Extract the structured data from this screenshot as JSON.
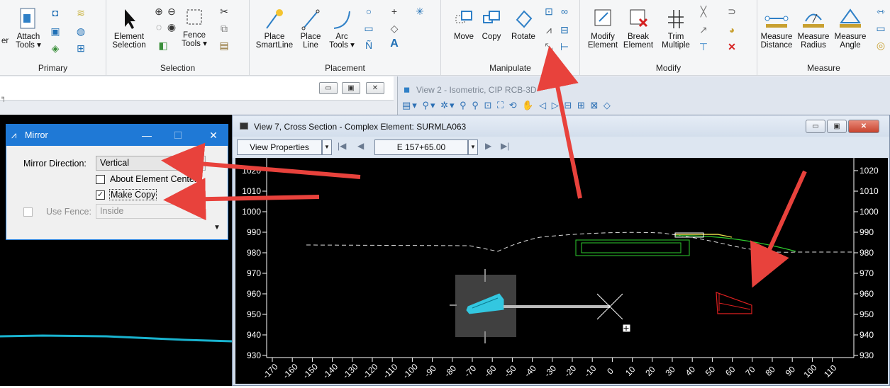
{
  "ribbon": {
    "groups": [
      {
        "label": "Primary",
        "buttons": [
          {
            "label": "Attach\nTools ▾"
          }
        ]
      },
      {
        "label": "Selection",
        "buttons": [
          {
            "label": "Element\nSelection"
          },
          {
            "label": "Fence\nTools ▾"
          }
        ]
      },
      {
        "label": "Placement",
        "buttons": [
          {
            "label": "Place\nSmartLine"
          },
          {
            "label": "Place\nLine"
          },
          {
            "label": "Arc\nTools ▾"
          }
        ]
      },
      {
        "label": "Manipulate",
        "buttons": [
          {
            "label": "Move"
          },
          {
            "label": "Copy"
          },
          {
            "label": "Rotate"
          }
        ]
      },
      {
        "label": "Modify",
        "buttons": [
          {
            "label": "Modify\nElement"
          },
          {
            "label": "Break\nElement"
          },
          {
            "label": "Trim\nMultiple"
          }
        ]
      },
      {
        "label": "Measure",
        "buttons": [
          {
            "label": "Measure\nDistance"
          },
          {
            "label": "Measure\nRadius"
          },
          {
            "label": "Measure\nAngle"
          }
        ]
      }
    ],
    "left_cut_text": "er"
  },
  "view2": {
    "title": "View 2 - Isometric, CIP RCB-3D"
  },
  "mirror": {
    "title": "Mirror",
    "direction_label": "Mirror Direction:",
    "direction_value": "Vertical",
    "about_center_label": "About Element Center",
    "about_center_checked": false,
    "make_copy_label": "Make Copy",
    "make_copy_checked": true,
    "use_fence_label": "Use Fence:",
    "use_fence_checked": false,
    "use_fence_value": "Inside"
  },
  "view7": {
    "title": "View 7, Cross Section - Complex Element: SURMLA063",
    "view_properties": "View Properties",
    "station": "E 157+65.00",
    "y_ticks": [
      "1020",
      "1010",
      "1000",
      "990",
      "980",
      "970",
      "960",
      "950",
      "940",
      "930"
    ],
    "x_ticks": [
      "-170",
      "-160",
      "-150",
      "-140",
      "-130",
      "-120",
      "-110",
      "-100",
      "-90",
      "-80",
      "-70",
      "-60",
      "-50",
      "-40",
      "-30",
      "-20",
      "-10",
      "0",
      "10",
      "20",
      "30",
      "40",
      "50",
      "60",
      "70",
      "80",
      "90",
      "100",
      "110"
    ]
  },
  "colors": {
    "ribbon_bg": "#f5f6f7",
    "dialog_title": "#1f79d6",
    "annotation_arrow": "#e8423c",
    "cyan_element": "#33c7e0",
    "green_element": "#2ecc2e",
    "red_element": "#e02020"
  }
}
